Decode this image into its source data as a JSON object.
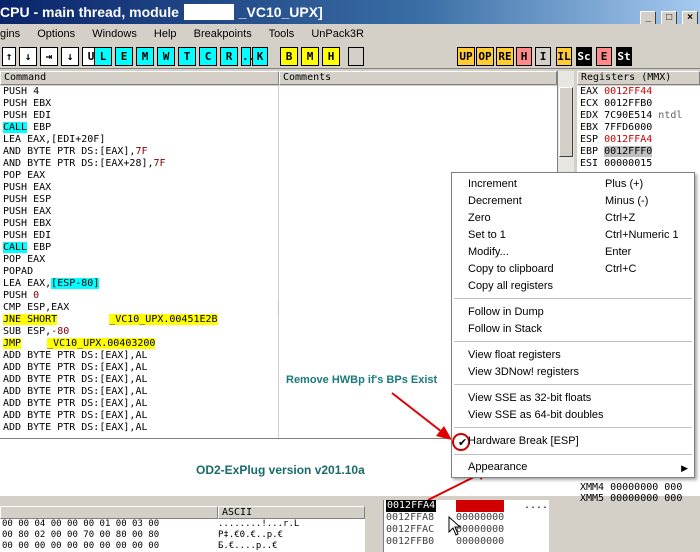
{
  "title": {
    "prefix": "CPU - main thread, module",
    "suffix": "_VC10_UPX]"
  },
  "window_buttons": [
    "_",
    "□",
    "×"
  ],
  "menu": [
    "gins",
    "Options",
    "Windows",
    "Help",
    "Breakpoints",
    "Tools",
    "UnPack3R"
  ],
  "toolbar": {
    "group1": [
      "↑",
      "↓",
      "⇥",
      "↓",
      "U"
    ],
    "group2": [
      "L",
      "E",
      "M",
      "W",
      "T",
      "C",
      "R",
      "...",
      "K"
    ],
    "group3": [
      "B",
      "M",
      "H"
    ],
    "group4": [
      "UP",
      "OP",
      "RE",
      "H",
      "I",
      "IL",
      "Sc",
      "E",
      "St"
    ]
  },
  "panes": {
    "command": "Command",
    "comments": "Comments",
    "registers": "Registers (MMX)",
    "ascii": "ASCII"
  },
  "code": [
    {
      "op": "PUSH 4"
    },
    {
      "op": "PUSH EBX"
    },
    {
      "op": "PUSH EDI"
    },
    {
      "op": "CALL",
      "arg": " EBP",
      "hl": "cyan"
    },
    {
      "op": "LEA EAX,[EDI+20F]"
    },
    {
      "op": "AND BYTE PTR DS:[EAX],",
      "num": "7F"
    },
    {
      "op": "AND BYTE PTR DS:[EAX+28],",
      "num": "7F"
    },
    {
      "op": "POP EAX"
    },
    {
      "op": "PUSH EAX"
    },
    {
      "op": "PUSH ESP"
    },
    {
      "op": "PUSH EAX"
    },
    {
      "op": "PUSH EBX"
    },
    {
      "op": "PUSH EDI"
    },
    {
      "op": "CALL",
      "arg": " EBP",
      "hl": "cyan"
    },
    {
      "op": "POP EAX"
    },
    {
      "op": "POPAD"
    },
    {
      "op": "LEA EAX,",
      "arg2": "[ESP-80]",
      "hl2": "cyan"
    },
    {
      "op": "PUSH",
      "num": " 0"
    },
    {
      "op": "CMP ESP,EAX",
      "selected": true
    },
    {
      "op": "JNE SHORT",
      "hl": "yellow",
      "mod": "_VC10_UPX.00451E2B"
    },
    {
      "op": "SUB ESP,",
      "num": "-80"
    },
    {
      "op": "JMP",
      "hl": "yellow",
      "mod": "_VC10_UPX.00403200"
    },
    {
      "op": "ADD BYTE PTR DS:[EAX],AL"
    },
    {
      "op": "ADD BYTE PTR DS:[EAX],AL"
    },
    {
      "op": "ADD BYTE PTR DS:[EAX],AL"
    },
    {
      "op": "ADD BYTE PTR DS:[EAX],AL"
    },
    {
      "op": "ADD BYTE PTR DS:[EAX],AL"
    },
    {
      "op": "ADD BYTE PTR DS:[EAX],AL"
    },
    {
      "op": "ADD BYTE PTR DS:[EAX],AL"
    }
  ],
  "registers": [
    {
      "name": "EAX",
      "value": "0012FF44",
      "red": true
    },
    {
      "name": "ECX",
      "value": "0012FFB0"
    },
    {
      "name": "EDX",
      "value": "7C90E514",
      "extra": "ntdl"
    },
    {
      "name": "EBX",
      "value": "7FFD6000"
    },
    {
      "name": "ESP",
      "value": "0012FFA4",
      "red": true
    },
    {
      "name": "EBP",
      "value": "0012FFF0",
      "ebp": true
    },
    {
      "name": "ESI",
      "value": "00000015"
    }
  ],
  "xmm": [
    "XMM4 00000000 000",
    "XMM5 00000000 000"
  ],
  "context_menu": {
    "items": [
      {
        "label": "Increment",
        "shortcut": "Plus (+)"
      },
      {
        "label": "Decrement",
        "shortcut": "Minus (-)"
      },
      {
        "label": "Zero",
        "shortcut": "Ctrl+Z"
      },
      {
        "label": "Set to 1",
        "shortcut": "Ctrl+Numeric 1"
      },
      {
        "label": "Modify...",
        "shortcut": "Enter"
      },
      {
        "label": "Copy to clipboard",
        "shortcut": "Ctrl+C"
      },
      {
        "label": "Copy all registers",
        "shortcut": ""
      },
      {
        "label": "Follow in Dump",
        "shortcut": ""
      },
      {
        "label": "Follow in Stack",
        "shortcut": ""
      },
      {
        "label": "View float registers",
        "shortcut": ""
      },
      {
        "label": "View 3DNow! registers",
        "shortcut": ""
      },
      {
        "label": "View SSE as 32-bit floats",
        "shortcut": ""
      },
      {
        "label": "View SSE as 64-bit doubles",
        "shortcut": ""
      },
      {
        "label": "Hardware Break [ESP]",
        "shortcut": ""
      },
      {
        "label": "Appearance",
        "shortcut": ""
      }
    ],
    "check_mark": "✔",
    "submenu_arrow": "▶"
  },
  "annotation": "Remove HWBp if's BPs Exist",
  "version": "OD2-ExPlug version v201.10a",
  "dump": [
    {
      "hex": "00 00 04 00 00 00 01 00 03 00",
      "ascii": "........!...r.L"
    },
    {
      "hex": "00 80 02 00 00 70 00 80 00 80",
      "ascii": "P‡.€0.€..p.€"
    },
    {
      "hex": "00 00 00 00 00 00 00 00 00 00",
      "ascii": "Б.€....р..€"
    }
  ],
  "stack": [
    {
      "addr": "0012FFA4",
      "value": "00000000",
      "sel": true
    },
    {
      "addr": "0012FFA8",
      "value": "00000000"
    },
    {
      "addr": "0012FFAC",
      "value": "00000000"
    },
    {
      "addr": "0012FFB0",
      "value": "00000000"
    }
  ],
  "stack_dots": "...."
}
